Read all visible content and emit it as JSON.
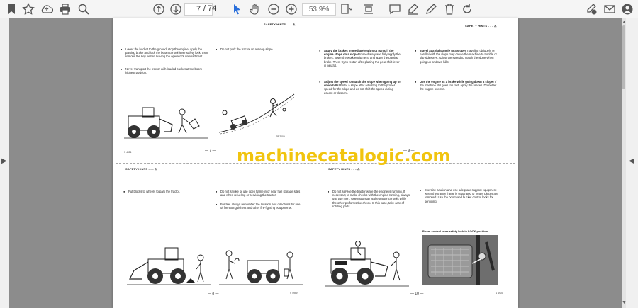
{
  "toolbar": {
    "current_page": "7",
    "page_separator": "/",
    "total_pages": "74",
    "zoom": "53,9%"
  },
  "document": {
    "watermark": "machinecatalogic.com",
    "pages": {
      "p7": {
        "header": "SAFETY HINTS - - - ⚠",
        "col1_bullet1": "Lower the bucket to the ground, stop the engine, apply the parking brake and lock the boom control lever safety lock, then remove the key before leaving the operator's compartment.",
        "col1_bullet2": "Never transport the tractor with loaded bucket at the boom highest position.",
        "col2_bullet1": "Do not park the tractor on a steep slope.",
        "fig_code": "SB 2009",
        "small_code": "S 4951",
        "page_number": "— 7 —"
      },
      "p8": {
        "header": "SAFETY HINTS - - - ⚠",
        "col1_bullet1": "Put blocks to wheels to park the tractor.",
        "col2_bullet1": "Do not smoke or use open flame in or near fuel storage sites and when refueling or servicing the tractor.",
        "col2_bullet2": "For fire, always remember the location and directions for use of fire extinguishers and other fire-fighting equipments.",
        "small_code": "S 4949",
        "page_number": "— 8 —"
      },
      "p9": {
        "header": "SAFETY HINTS - - - ⚠",
        "col1_bullet1_title": "Apply the brakes immediately without panic if the engine stops on a slope!",
        "col1_bullet1": "Immediately and fully apply the brakes, lower the work equipment, and apply the parking brake. Then, try to restart after placing the gear shift lever in neutral.",
        "col1_bullet2_title": "Adjust the speed to match the slope when going up or down hills!",
        "col1_bullet2": "Enter a slope after adjusting to the proper speed for the slope and do not shift the speed during ascent or descent.",
        "col2_bullet1_title": "Travel at a right angle to a slope!",
        "col2_bullet1": "Traveling obliquely or parallel with the slope may cause the machine to tumble or slip sideways. Adjust the speed to match the slope when going up or down hills!",
        "col2_bullet2_title": "Use the engine as a brake while going down a slope!",
        "col2_bullet2": "If the machine still goes too fast, apply the brakes. Do not let the engine overrun.",
        "page_number": "— 9 —"
      },
      "p10": {
        "header": "SAFETY HINTS - - - ⚠",
        "col1_bullet1": "Do not service the tractor while the engine is running. If necessary to make checks with the engine running, always use two men. One must stay at the tractor controls while the other performs the check. In this case, take care of rotating parts.",
        "col2_bullet1": "Exercise caution and use adequate support equipment when the tractor frame is separated or heavy pieces are removed. Use the boom and bucket control locks for servicing.",
        "photo_caption": "Boom control lever safety lock in LOCK position",
        "small_code": "S 4903",
        "page_number": "— 10 —"
      }
    }
  }
}
